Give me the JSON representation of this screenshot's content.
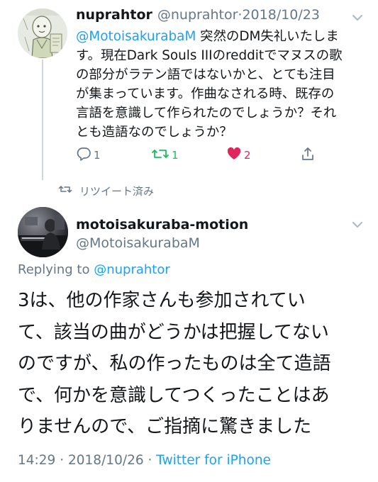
{
  "tweet1": {
    "display_name": "nuprahtor",
    "handle": "@nuprahtor",
    "separator": "·",
    "date": "2018/10/23",
    "mention": "@MotoisakurabaM",
    "body_line1_rest": " 突然のDM失礼いたしま",
    "body_lines": [
      "す。現在Dark Souls IIIのredditでマヌスの歌",
      "の部分がラテン語ではないかと、とても注目",
      "が集まっています。作曲なされる時、既存の",
      "言語を意識して作られたのでしょうか？それ",
      "とも造語なのでしょうか？"
    ],
    "reply_count": "1",
    "retweet_count": "1",
    "like_count": "2",
    "retweeted_label": "リツイート済み"
  },
  "tweet2": {
    "display_name": "motoisakuraba-motion",
    "handle": "@MotoisakurabaM",
    "replying_prefix": "Replying to ",
    "replying_to": "@nuprahtor",
    "body_lines": [
      "3は、他の作家さんも参加されてい",
      "て、該当の曲がどうかは把握してない",
      "のですが、私の作ったものは全て造語",
      "で、何かを意識してつくったことはあ",
      "りませんので、ご指摘に驚きました"
    ],
    "time": "14:29",
    "separator": " · ",
    "date": "2018/10/26",
    "source": "Twitter for iPhone"
  },
  "colors": {
    "text": "#14171a",
    "secondary": "#657786",
    "link": "#1da1f2",
    "retweet": "#17bf63",
    "like": "#e0245e",
    "divider": "#ccd6dd"
  },
  "icons": {
    "reply": "reply-icon",
    "retweet": "retweet-icon",
    "like": "heart-icon",
    "share": "share-icon",
    "caret": "chevron-down-icon"
  }
}
